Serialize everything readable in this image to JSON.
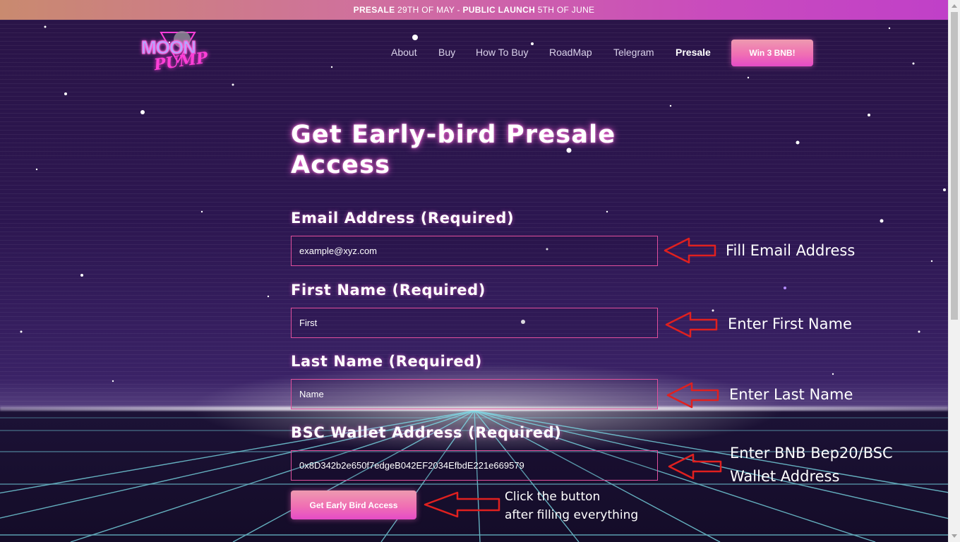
{
  "announcement": {
    "part1_bold": "PRESALE",
    "part2": " 29TH OF MAY - ",
    "part3_bold": "PUBLIC LAUNCH",
    "part4": " 5TH OF JUNE"
  },
  "logo": {
    "line1": "MOON",
    "line2": "PUMP"
  },
  "nav": {
    "items": [
      {
        "label": "About"
      },
      {
        "label": "Buy"
      },
      {
        "label": "How To Buy"
      },
      {
        "label": "RoadMap"
      },
      {
        "label": "Telegram"
      },
      {
        "label": "Presale",
        "active": true
      }
    ],
    "cta_label": "Win 3 BNB!"
  },
  "form": {
    "headline": "Get Early-bird Presale Access",
    "fields": [
      {
        "label": "Email Address (Required)",
        "value": "example@xyz.com"
      },
      {
        "label": "First Name (Required)",
        "value": "First"
      },
      {
        "label": "Last Name (Required)",
        "value": "Name"
      },
      {
        "label": "BSC Wallet Address (Required)",
        "value": "0x8D342b2e650f7edgeB042EF2034EfbdE221e669579"
      }
    ],
    "submit_label": "Get Early Bird Access"
  },
  "annotations": {
    "email": "Fill Email Address",
    "first_name": "Enter First Name",
    "last_name": "Enter Last Name",
    "wallet_line1": "Enter BNB Bep20/BSC",
    "wallet_line2": "Wallet Address",
    "button_line1": "Click the button",
    "button_line2": "after filling everything"
  },
  "colors": {
    "accent_pink": "#f06fb3",
    "field_border": "#e1509d",
    "annotation_arrow": "#e0201f"
  }
}
